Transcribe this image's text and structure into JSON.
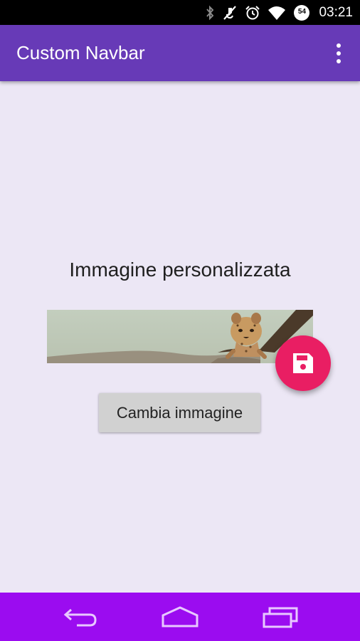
{
  "status_bar": {
    "time": "03:21",
    "battery_level": "54",
    "icons": [
      "bluetooth-icon",
      "mute-icon",
      "alarm-icon",
      "wifi-icon",
      "battery-icon"
    ]
  },
  "app_bar": {
    "title": "Custom Navbar",
    "menu_icon": "overflow-menu-icon"
  },
  "content": {
    "heading": "Immagine personalizzata",
    "image_subject": "cheetah-cub-banner",
    "change_button_label": "Cambia immagine",
    "fab_icon": "save-icon"
  },
  "nav_bar": {
    "icons": [
      "back-icon",
      "home-icon",
      "recents-icon"
    ]
  },
  "colors": {
    "app_bar": "#673AB7",
    "background": "#ECE7F5",
    "fab": "#E91E63",
    "nav_bar": "#9B0CF0"
  }
}
